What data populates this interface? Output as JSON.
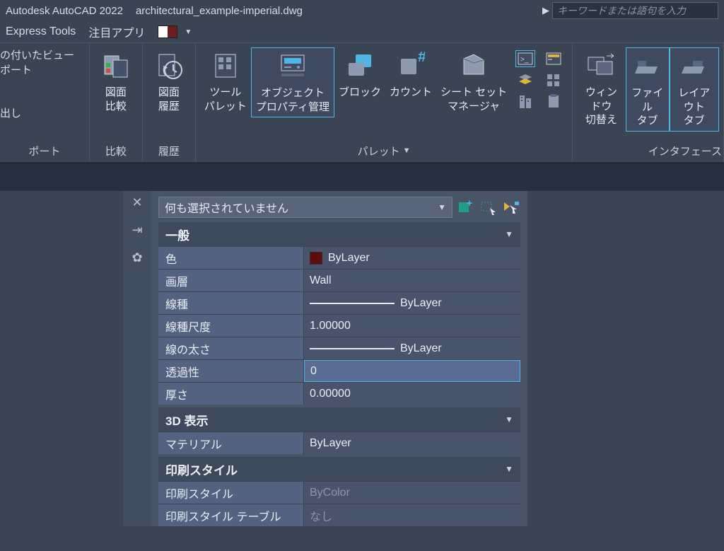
{
  "titlebar": {
    "app": "Autodesk AutoCAD 2022",
    "file": "architectural_example-imperial.dwg",
    "search_placeholder": "キーワードまたは語句を入力"
  },
  "tabrow": {
    "tab1": "Express Tools",
    "tab2": "注目アプリ"
  },
  "ribbon": {
    "viewport_partial1": "の付いたビューポート",
    "viewport_partial2": "出し",
    "viewport_panel": "ポート",
    "compare_btn": "図面\n比較",
    "compare_panel": "比較",
    "history_btn": "図面\n履歴",
    "history_panel": "履歴",
    "tool_palettes": "ツール\nパレット",
    "properties_mgr": "オブジェクト\nプロパティ管理",
    "blocks": "ブロック",
    "count": "カウント",
    "sheet_mgr": "シート セット\nマネージャ",
    "palette_panel": "パレット",
    "switch_win": "ウィンドウ\n切替え",
    "file_tab": "ファイル\nタブ",
    "layout_tab": "レイアウト\nタブ",
    "interface_panel": "インタフェース"
  },
  "palette": {
    "selection": "何も選択されていません",
    "sections": {
      "general": "一般",
      "disp3d": "3D 表示",
      "printstyle": "印刷スタイル"
    },
    "props": {
      "color_l": "色",
      "color_v": "ByLayer",
      "layer_l": "画層",
      "layer_v": "Wall",
      "ltype_l": "線種",
      "ltype_v": "ByLayer",
      "ltscale_l": "線種尺度",
      "ltscale_v": "1.00000",
      "lweight_l": "線の太さ",
      "lweight_v": "ByLayer",
      "transp_l": "透過性",
      "transp_v": "0",
      "thick_l": "厚さ",
      "thick_v": "0.00000",
      "material_l": "マテリアル",
      "material_v": "ByLayer",
      "pstyle_l": "印刷スタイル",
      "pstyle_v": "ByColor",
      "ptable_l": "印刷スタイル テーブル",
      "ptable_v": "なし"
    }
  }
}
